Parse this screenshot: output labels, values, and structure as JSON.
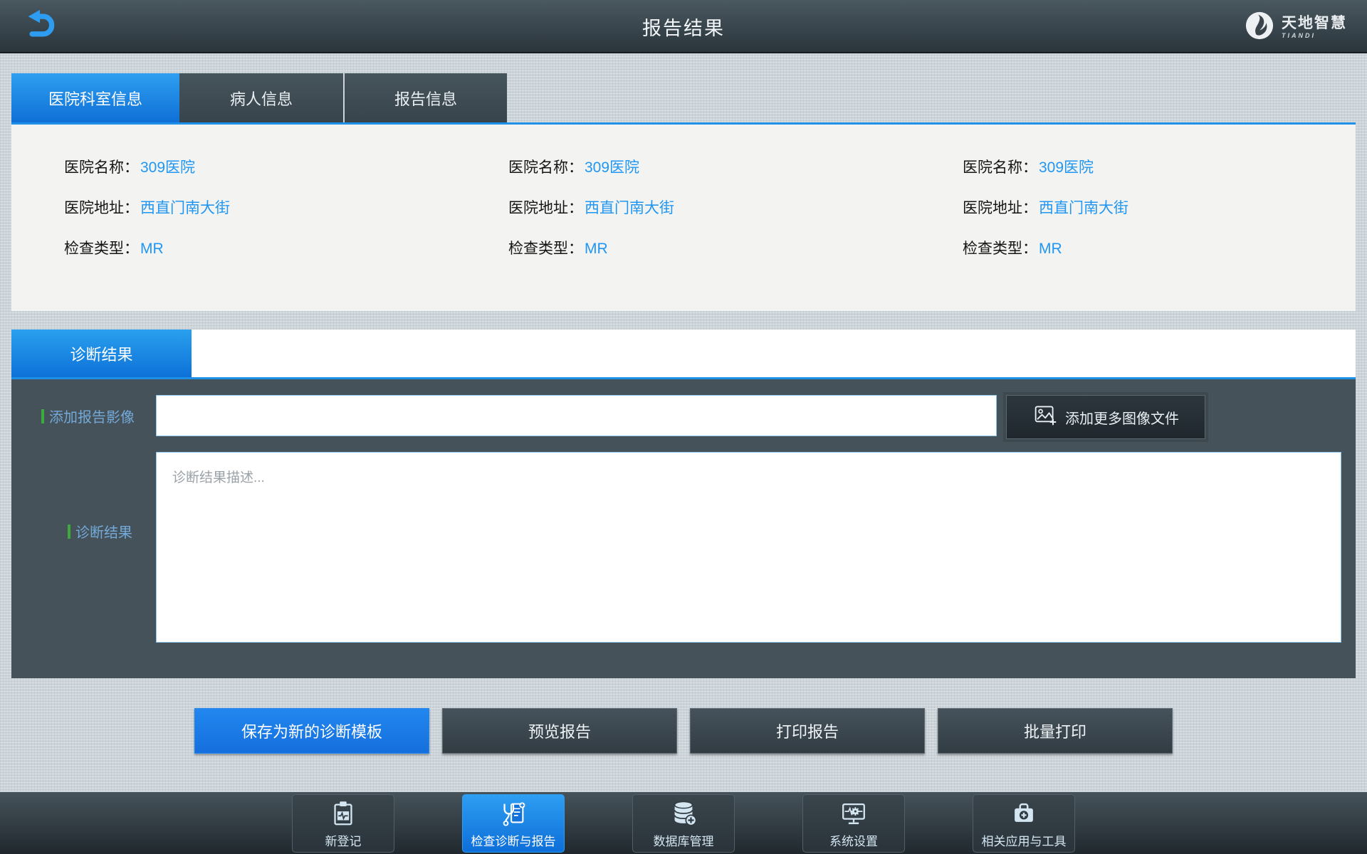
{
  "header": {
    "title": "报告结果",
    "logo_text": "天地智慧",
    "logo_subtext": "TIANDI"
  },
  "tabs": [
    {
      "label": "医院科室信息",
      "active": true
    },
    {
      "label": "病人信息",
      "active": false
    },
    {
      "label": "报告信息",
      "active": false
    }
  ],
  "info_panel": {
    "columns": [
      {
        "rows": [
          {
            "label": "医院名称：",
            "value": "309医院"
          },
          {
            "label": "医院地址：",
            "value": "西直门南大街"
          },
          {
            "label": "检查类型：",
            "value": "MR"
          }
        ]
      },
      {
        "rows": [
          {
            "label": "医院名称：",
            "value": "309医院"
          },
          {
            "label": "医院地址：",
            "value": "西直门南大街"
          },
          {
            "label": "检查类型：",
            "value": "MR"
          }
        ]
      },
      {
        "rows": [
          {
            "label": "医院名称：",
            "value": "309医院"
          },
          {
            "label": "医院地址：",
            "value": "西直门南大街"
          },
          {
            "label": "检查类型：",
            "value": "MR"
          }
        ]
      }
    ]
  },
  "diagnosis": {
    "tab_label": "诊断结果",
    "image_field": {
      "label": "添加报告影像",
      "value": ""
    },
    "add_images_button": "添加更多图像文件",
    "result_field": {
      "label": "诊断结果",
      "placeholder": "诊断结果描述..."
    }
  },
  "actions": {
    "buttons": [
      {
        "label": "保存为新的诊断模板",
        "primary": true
      },
      {
        "label": "预览报告",
        "primary": false
      },
      {
        "label": "打印报告",
        "primary": false
      },
      {
        "label": "批量打印",
        "primary": false
      }
    ]
  },
  "nav": {
    "items": [
      {
        "label": "新登记",
        "icon": "clipboard-icon",
        "active": false
      },
      {
        "label": "检查诊断与报告",
        "icon": "stethoscope-report-icon",
        "active": true
      },
      {
        "label": "数据库管理",
        "icon": "database-icon",
        "active": false
      },
      {
        "label": "系统设置",
        "icon": "monitor-settings-icon",
        "active": false
      },
      {
        "label": "相关应用与工具",
        "icon": "toolbox-icon",
        "active": false
      }
    ]
  },
  "colors": {
    "accent_blue": "#1e90e8",
    "link_blue": "#2196f3",
    "green_marker": "#3caa3c",
    "panel_dark": "#46525a",
    "panel_light": "#f3f3f1"
  }
}
